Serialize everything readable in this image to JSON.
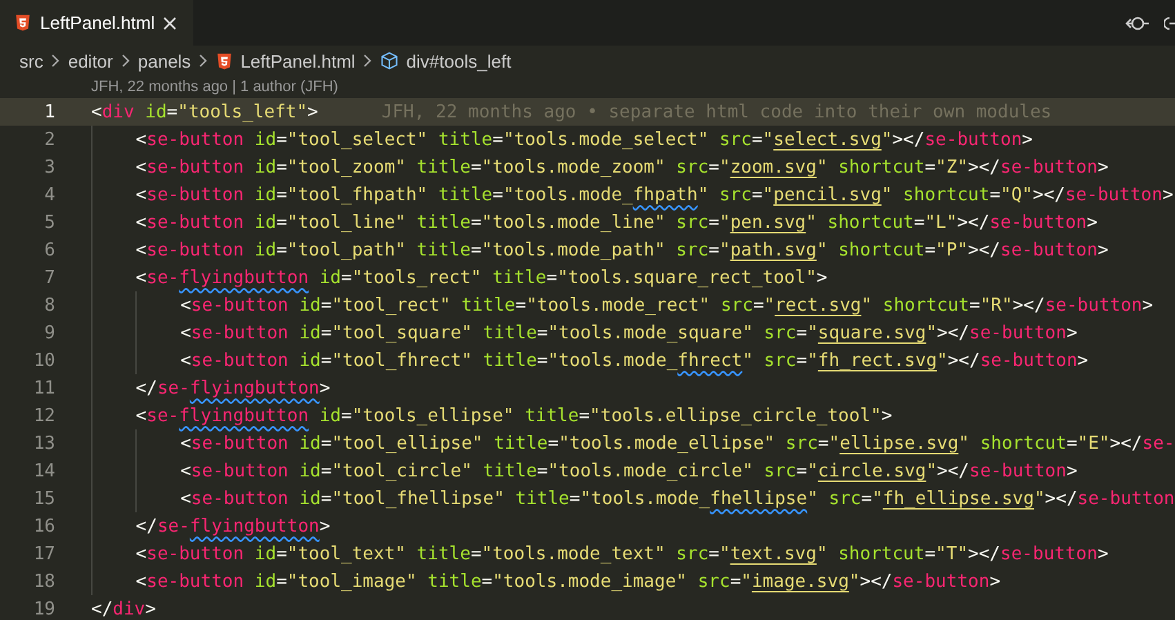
{
  "tabs": [
    {
      "label": "LeftPanel.html",
      "selected": true
    }
  ],
  "breadcrumb": [
    {
      "label": "src",
      "kind": "folder"
    },
    {
      "label": "editor",
      "kind": "folder"
    },
    {
      "label": "panels",
      "kind": "folder"
    },
    {
      "label": "LeftPanel.html",
      "kind": "html"
    },
    {
      "label": "div#tools_left",
      "kind": "element"
    }
  ],
  "codelens": "JFH, 22 months ago | 1 author (JFH)",
  "lines": [
    {
      "number": "1",
      "selected": true,
      "blame": "JFH, 22 months ago • separate html code into their own modules",
      "tokens": [
        {
          "kind": "p",
          "text": "<"
        },
        {
          "kind": "tag",
          "text": "div"
        },
        {
          "kind": "attr",
          "text": " id"
        },
        {
          "kind": "p",
          "text": "="
        },
        {
          "kind": "str",
          "text": "\"tools_left\""
        },
        {
          "kind": "p",
          "text": ">"
        }
      ],
      "children": [
        {
          "number": "2",
          "selected": false,
          "tokens": [
            {
              "kind": "p",
              "text": "<"
            },
            {
              "kind": "tag",
              "text": "se-button"
            },
            {
              "kind": "attr",
              "text": " id"
            },
            {
              "kind": "p",
              "text": "="
            },
            {
              "kind": "str",
              "text": "\"tool_select\""
            },
            {
              "kind": "attr",
              "text": " title"
            },
            {
              "kind": "p",
              "text": "="
            },
            {
              "kind": "str",
              "text": "\"tools.mode_select\""
            },
            {
              "kind": "attr",
              "text": " src"
            },
            {
              "kind": "p",
              "text": "="
            },
            {
              "kind": "str",
              "text": "\""
            },
            {
              "kind": "link",
              "text": "select.svg"
            },
            {
              "kind": "str",
              "text": "\""
            },
            {
              "kind": "p",
              "text": "></"
            },
            {
              "kind": "tag",
              "text": "se-button"
            },
            {
              "kind": "p",
              "text": ">"
            }
          ]
        },
        {
          "number": "3",
          "selected": false,
          "tokens": [
            {
              "kind": "p",
              "text": "<"
            },
            {
              "kind": "tag",
              "text": "se-button"
            },
            {
              "kind": "attr",
              "text": " id"
            },
            {
              "kind": "p",
              "text": "="
            },
            {
              "kind": "str",
              "text": "\"tool_zoom\""
            },
            {
              "kind": "attr",
              "text": " title"
            },
            {
              "kind": "p",
              "text": "="
            },
            {
              "kind": "str",
              "text": "\"tools.mode_zoom\""
            },
            {
              "kind": "attr",
              "text": " src"
            },
            {
              "kind": "p",
              "text": "="
            },
            {
              "kind": "str",
              "text": "\""
            },
            {
              "kind": "link",
              "text": "zoom.svg"
            },
            {
              "kind": "str",
              "text": "\""
            },
            {
              "kind": "attr",
              "text": " shortcut"
            },
            {
              "kind": "p",
              "text": "="
            },
            {
              "kind": "str",
              "text": "\"Z\""
            },
            {
              "kind": "p",
              "text": "></"
            },
            {
              "kind": "tag",
              "text": "se-button"
            },
            {
              "kind": "p",
              "text": ">"
            }
          ]
        },
        {
          "number": "4",
          "selected": false,
          "tokens": [
            {
              "kind": "p",
              "text": "<"
            },
            {
              "kind": "tag",
              "text": "se-button"
            },
            {
              "kind": "attr",
              "text": " id"
            },
            {
              "kind": "p",
              "text": "="
            },
            {
              "kind": "str",
              "text": "\"tool_fhpath\""
            },
            {
              "kind": "attr",
              "text": " title"
            },
            {
              "kind": "p",
              "text": "="
            },
            {
              "kind": "str",
              "text": "\"tools.mode_"
            },
            {
              "kind": "warn",
              "text": "fhpath"
            },
            {
              "kind": "str",
              "text": "\""
            },
            {
              "kind": "attr",
              "text": " src"
            },
            {
              "kind": "p",
              "text": "="
            },
            {
              "kind": "str",
              "text": "\""
            },
            {
              "kind": "link",
              "text": "pencil.svg"
            },
            {
              "kind": "str",
              "text": "\""
            },
            {
              "kind": "attr",
              "text": " shortcut"
            },
            {
              "kind": "p",
              "text": "="
            },
            {
              "kind": "str",
              "text": "\"Q\""
            },
            {
              "kind": "p",
              "text": "></"
            },
            {
              "kind": "tag",
              "text": "se-button"
            },
            {
              "kind": "p",
              "text": ">"
            }
          ]
        },
        {
          "number": "5",
          "selected": false,
          "tokens": [
            {
              "kind": "p",
              "text": "<"
            },
            {
              "kind": "tag",
              "text": "se-button"
            },
            {
              "kind": "attr",
              "text": " id"
            },
            {
              "kind": "p",
              "text": "="
            },
            {
              "kind": "str",
              "text": "\"tool_line\""
            },
            {
              "kind": "attr",
              "text": " title"
            },
            {
              "kind": "p",
              "text": "="
            },
            {
              "kind": "str",
              "text": "\"tools.mode_line\""
            },
            {
              "kind": "attr",
              "text": " src"
            },
            {
              "kind": "p",
              "text": "="
            },
            {
              "kind": "str",
              "text": "\""
            },
            {
              "kind": "link",
              "text": "pen.svg"
            },
            {
              "kind": "str",
              "text": "\""
            },
            {
              "kind": "attr",
              "text": " shortcut"
            },
            {
              "kind": "p",
              "text": "="
            },
            {
              "kind": "str",
              "text": "\"L\""
            },
            {
              "kind": "p",
              "text": "></"
            },
            {
              "kind": "tag",
              "text": "se-button"
            },
            {
              "kind": "p",
              "text": ">"
            }
          ]
        },
        {
          "number": "6",
          "selected": false,
          "tokens": [
            {
              "kind": "p",
              "text": "<"
            },
            {
              "kind": "tag",
              "text": "se-button"
            },
            {
              "kind": "attr",
              "text": " id"
            },
            {
              "kind": "p",
              "text": "="
            },
            {
              "kind": "str",
              "text": "\"tool_path\""
            },
            {
              "kind": "attr",
              "text": " title"
            },
            {
              "kind": "p",
              "text": "="
            },
            {
              "kind": "str",
              "text": "\"tools.mode_path\""
            },
            {
              "kind": "attr",
              "text": " src"
            },
            {
              "kind": "p",
              "text": "="
            },
            {
              "kind": "str",
              "text": "\""
            },
            {
              "kind": "link",
              "text": "path.svg"
            },
            {
              "kind": "str",
              "text": "\""
            },
            {
              "kind": "attr",
              "text": " shortcut"
            },
            {
              "kind": "p",
              "text": "="
            },
            {
              "kind": "str",
              "text": "\"P\""
            },
            {
              "kind": "p",
              "text": "></"
            },
            {
              "kind": "tag",
              "text": "se-button"
            },
            {
              "kind": "p",
              "text": ">"
            }
          ]
        },
        {
          "number": "7",
          "selected": false,
          "tokens": [
            {
              "kind": "p",
              "text": "<"
            },
            {
              "kind": "tag",
              "text": "se-"
            },
            {
              "kind": "tagwarn",
              "text": "flyingbutton"
            },
            {
              "kind": "attr",
              "text": " id"
            },
            {
              "kind": "p",
              "text": "="
            },
            {
              "kind": "str",
              "text": "\"tools_rect\""
            },
            {
              "kind": "attr",
              "text": " title"
            },
            {
              "kind": "p",
              "text": "="
            },
            {
              "kind": "str",
              "text": "\"tools.square_rect_tool\""
            },
            {
              "kind": "p",
              "text": ">"
            }
          ],
          "children": [
            {
              "number": "8",
              "selected": false,
              "tokens": [
                {
                  "kind": "p",
                  "text": "<"
                },
                {
                  "kind": "tag",
                  "text": "se-button"
                },
                {
                  "kind": "attr",
                  "text": " id"
                },
                {
                  "kind": "p",
                  "text": "="
                },
                {
                  "kind": "str",
                  "text": "\"tool_rect\""
                },
                {
                  "kind": "attr",
                  "text": " title"
                },
                {
                  "kind": "p",
                  "text": "="
                },
                {
                  "kind": "str",
                  "text": "\"tools.mode_rect\""
                },
                {
                  "kind": "attr",
                  "text": " src"
                },
                {
                  "kind": "p",
                  "text": "="
                },
                {
                  "kind": "str",
                  "text": "\""
                },
                {
                  "kind": "link",
                  "text": "rect.svg"
                },
                {
                  "kind": "str",
                  "text": "\""
                },
                {
                  "kind": "attr",
                  "text": " shortcut"
                },
                {
                  "kind": "p",
                  "text": "="
                },
                {
                  "kind": "str",
                  "text": "\"R\""
                },
                {
                  "kind": "p",
                  "text": "></"
                },
                {
                  "kind": "tag",
                  "text": "se-button"
                },
                {
                  "kind": "p",
                  "text": ">"
                }
              ]
            },
            {
              "number": "9",
              "selected": false,
              "tokens": [
                {
                  "kind": "p",
                  "text": "<"
                },
                {
                  "kind": "tag",
                  "text": "se-button"
                },
                {
                  "kind": "attr",
                  "text": " id"
                },
                {
                  "kind": "p",
                  "text": "="
                },
                {
                  "kind": "str",
                  "text": "\"tool_square\""
                },
                {
                  "kind": "attr",
                  "text": " title"
                },
                {
                  "kind": "p",
                  "text": "="
                },
                {
                  "kind": "str",
                  "text": "\"tools.mode_square\""
                },
                {
                  "kind": "attr",
                  "text": " src"
                },
                {
                  "kind": "p",
                  "text": "="
                },
                {
                  "kind": "str",
                  "text": "\""
                },
                {
                  "kind": "link",
                  "text": "square.svg"
                },
                {
                  "kind": "str",
                  "text": "\""
                },
                {
                  "kind": "p",
                  "text": "></"
                },
                {
                  "kind": "tag",
                  "text": "se-button"
                },
                {
                  "kind": "p",
                  "text": ">"
                }
              ]
            },
            {
              "number": "10",
              "selected": false,
              "tokens": [
                {
                  "kind": "p",
                  "text": "<"
                },
                {
                  "kind": "tag",
                  "text": "se-button"
                },
                {
                  "kind": "attr",
                  "text": " id"
                },
                {
                  "kind": "p",
                  "text": "="
                },
                {
                  "kind": "str",
                  "text": "\"tool_fhrect\""
                },
                {
                  "kind": "attr",
                  "text": " title"
                },
                {
                  "kind": "p",
                  "text": "="
                },
                {
                  "kind": "str",
                  "text": "\"tools.mode_"
                },
                {
                  "kind": "warn",
                  "text": "fhrect"
                },
                {
                  "kind": "str",
                  "text": "\""
                },
                {
                  "kind": "attr",
                  "text": " src"
                },
                {
                  "kind": "p",
                  "text": "="
                },
                {
                  "kind": "str",
                  "text": "\""
                },
                {
                  "kind": "link",
                  "text": "fh_rect.svg"
                },
                {
                  "kind": "str",
                  "text": "\""
                },
                {
                  "kind": "p",
                  "text": "></"
                },
                {
                  "kind": "tag",
                  "text": "se-button"
                },
                {
                  "kind": "p",
                  "text": ">"
                }
              ]
            }
          ]
        },
        {
          "number": "11",
          "selected": false,
          "tokens": [
            {
              "kind": "p",
              "text": "</"
            },
            {
              "kind": "tag",
              "text": "se-"
            },
            {
              "kind": "tagwarn",
              "text": "flyingbutton"
            },
            {
              "kind": "p",
              "text": ">"
            }
          ]
        },
        {
          "number": "12",
          "selected": false,
          "tokens": [
            {
              "kind": "p",
              "text": "<"
            },
            {
              "kind": "tag",
              "text": "se-"
            },
            {
              "kind": "tagwarn",
              "text": "flyingbutton"
            },
            {
              "kind": "attr",
              "text": " id"
            },
            {
              "kind": "p",
              "text": "="
            },
            {
              "kind": "str",
              "text": "\"tools_ellipse\""
            },
            {
              "kind": "attr",
              "text": " title"
            },
            {
              "kind": "p",
              "text": "="
            },
            {
              "kind": "str",
              "text": "\"tools.ellipse_circle_tool\""
            },
            {
              "kind": "p",
              "text": ">"
            }
          ],
          "children": [
            {
              "number": "13",
              "selected": false,
              "tokens": [
                {
                  "kind": "p",
                  "text": "<"
                },
                {
                  "kind": "tag",
                  "text": "se-button"
                },
                {
                  "kind": "attr",
                  "text": " id"
                },
                {
                  "kind": "p",
                  "text": "="
                },
                {
                  "kind": "str",
                  "text": "\"tool_ellipse\""
                },
                {
                  "kind": "attr",
                  "text": " title"
                },
                {
                  "kind": "p",
                  "text": "="
                },
                {
                  "kind": "str",
                  "text": "\"tools.mode_ellipse\""
                },
                {
                  "kind": "attr",
                  "text": " src"
                },
                {
                  "kind": "p",
                  "text": "="
                },
                {
                  "kind": "str",
                  "text": "\""
                },
                {
                  "kind": "link",
                  "text": "ellipse.svg"
                },
                {
                  "kind": "str",
                  "text": "\""
                },
                {
                  "kind": "attr",
                  "text": " shortcut"
                },
                {
                  "kind": "p",
                  "text": "="
                },
                {
                  "kind": "str",
                  "text": "\"E\""
                },
                {
                  "kind": "p",
                  "text": "></"
                },
                {
                  "kind": "tag",
                  "text": "se-"
                }
              ]
            },
            {
              "number": "14",
              "selected": false,
              "tokens": [
                {
                  "kind": "p",
                  "text": "<"
                },
                {
                  "kind": "tag",
                  "text": "se-button"
                },
                {
                  "kind": "attr",
                  "text": " id"
                },
                {
                  "kind": "p",
                  "text": "="
                },
                {
                  "kind": "str",
                  "text": "\"tool_circle\""
                },
                {
                  "kind": "attr",
                  "text": " title"
                },
                {
                  "kind": "p",
                  "text": "="
                },
                {
                  "kind": "str",
                  "text": "\"tools.mode_circle\""
                },
                {
                  "kind": "attr",
                  "text": " src"
                },
                {
                  "kind": "p",
                  "text": "="
                },
                {
                  "kind": "str",
                  "text": "\""
                },
                {
                  "kind": "link",
                  "text": "circle.svg"
                },
                {
                  "kind": "str",
                  "text": "\""
                },
                {
                  "kind": "p",
                  "text": "></"
                },
                {
                  "kind": "tag",
                  "text": "se-button"
                },
                {
                  "kind": "p",
                  "text": ">"
                }
              ]
            },
            {
              "number": "15",
              "selected": false,
              "tokens": [
                {
                  "kind": "p",
                  "text": "<"
                },
                {
                  "kind": "tag",
                  "text": "se-button"
                },
                {
                  "kind": "attr",
                  "text": " id"
                },
                {
                  "kind": "p",
                  "text": "="
                },
                {
                  "kind": "str",
                  "text": "\"tool_fhellipse\""
                },
                {
                  "kind": "attr",
                  "text": " title"
                },
                {
                  "kind": "p",
                  "text": "="
                },
                {
                  "kind": "str",
                  "text": "\"tools.mode_"
                },
                {
                  "kind": "warn",
                  "text": "fhellipse"
                },
                {
                  "kind": "str",
                  "text": "\""
                },
                {
                  "kind": "attr",
                  "text": " src"
                },
                {
                  "kind": "p",
                  "text": "="
                },
                {
                  "kind": "str",
                  "text": "\""
                },
                {
                  "kind": "link",
                  "text": "fh_ellipse.svg"
                },
                {
                  "kind": "str",
                  "text": "\""
                },
                {
                  "kind": "p",
                  "text": "></"
                },
                {
                  "kind": "tag",
                  "text": "se-button"
                }
              ]
            }
          ]
        },
        {
          "number": "16",
          "selected": false,
          "tokens": [
            {
              "kind": "p",
              "text": "</"
            },
            {
              "kind": "tag",
              "text": "se-"
            },
            {
              "kind": "tagwarn",
              "text": "flyingbutton"
            },
            {
              "kind": "p",
              "text": ">"
            }
          ]
        },
        {
          "number": "17",
          "selected": false,
          "tokens": [
            {
              "kind": "p",
              "text": "<"
            },
            {
              "kind": "tag",
              "text": "se-button"
            },
            {
              "kind": "attr",
              "text": " id"
            },
            {
              "kind": "p",
              "text": "="
            },
            {
              "kind": "str",
              "text": "\"tool_text\""
            },
            {
              "kind": "attr",
              "text": " title"
            },
            {
              "kind": "p",
              "text": "="
            },
            {
              "kind": "str",
              "text": "\"tools.mode_text\""
            },
            {
              "kind": "attr",
              "text": " src"
            },
            {
              "kind": "p",
              "text": "="
            },
            {
              "kind": "str",
              "text": "\""
            },
            {
              "kind": "link",
              "text": "text.svg"
            },
            {
              "kind": "str",
              "text": "\""
            },
            {
              "kind": "attr",
              "text": " shortcut"
            },
            {
              "kind": "p",
              "text": "="
            },
            {
              "kind": "str",
              "text": "\"T\""
            },
            {
              "kind": "p",
              "text": "></"
            },
            {
              "kind": "tag",
              "text": "se-button"
            },
            {
              "kind": "p",
              "text": ">"
            }
          ]
        },
        {
          "number": "18",
          "selected": false,
          "tokens": [
            {
              "kind": "p",
              "text": "<"
            },
            {
              "kind": "tag",
              "text": "se-button"
            },
            {
              "kind": "attr",
              "text": " id"
            },
            {
              "kind": "p",
              "text": "="
            },
            {
              "kind": "str",
              "text": "\"tool_image\""
            },
            {
              "kind": "attr",
              "text": " title"
            },
            {
              "kind": "p",
              "text": "="
            },
            {
              "kind": "str",
              "text": "\"tools.mode_image\""
            },
            {
              "kind": "attr",
              "text": " src"
            },
            {
              "kind": "p",
              "text": "="
            },
            {
              "kind": "str",
              "text": "\""
            },
            {
              "kind": "link",
              "text": "image.svg"
            },
            {
              "kind": "str",
              "text": "\""
            },
            {
              "kind": "p",
              "text": "></"
            },
            {
              "kind": "tag",
              "text": "se-button"
            },
            {
              "kind": "p",
              "text": ">"
            }
          ]
        }
      ]
    },
    {
      "number": "19",
      "selected": false,
      "tokens": [
        {
          "kind": "p",
          "text": "</"
        },
        {
          "kind": "tag",
          "text": "div"
        },
        {
          "kind": "p",
          "text": ">"
        }
      ]
    }
  ]
}
